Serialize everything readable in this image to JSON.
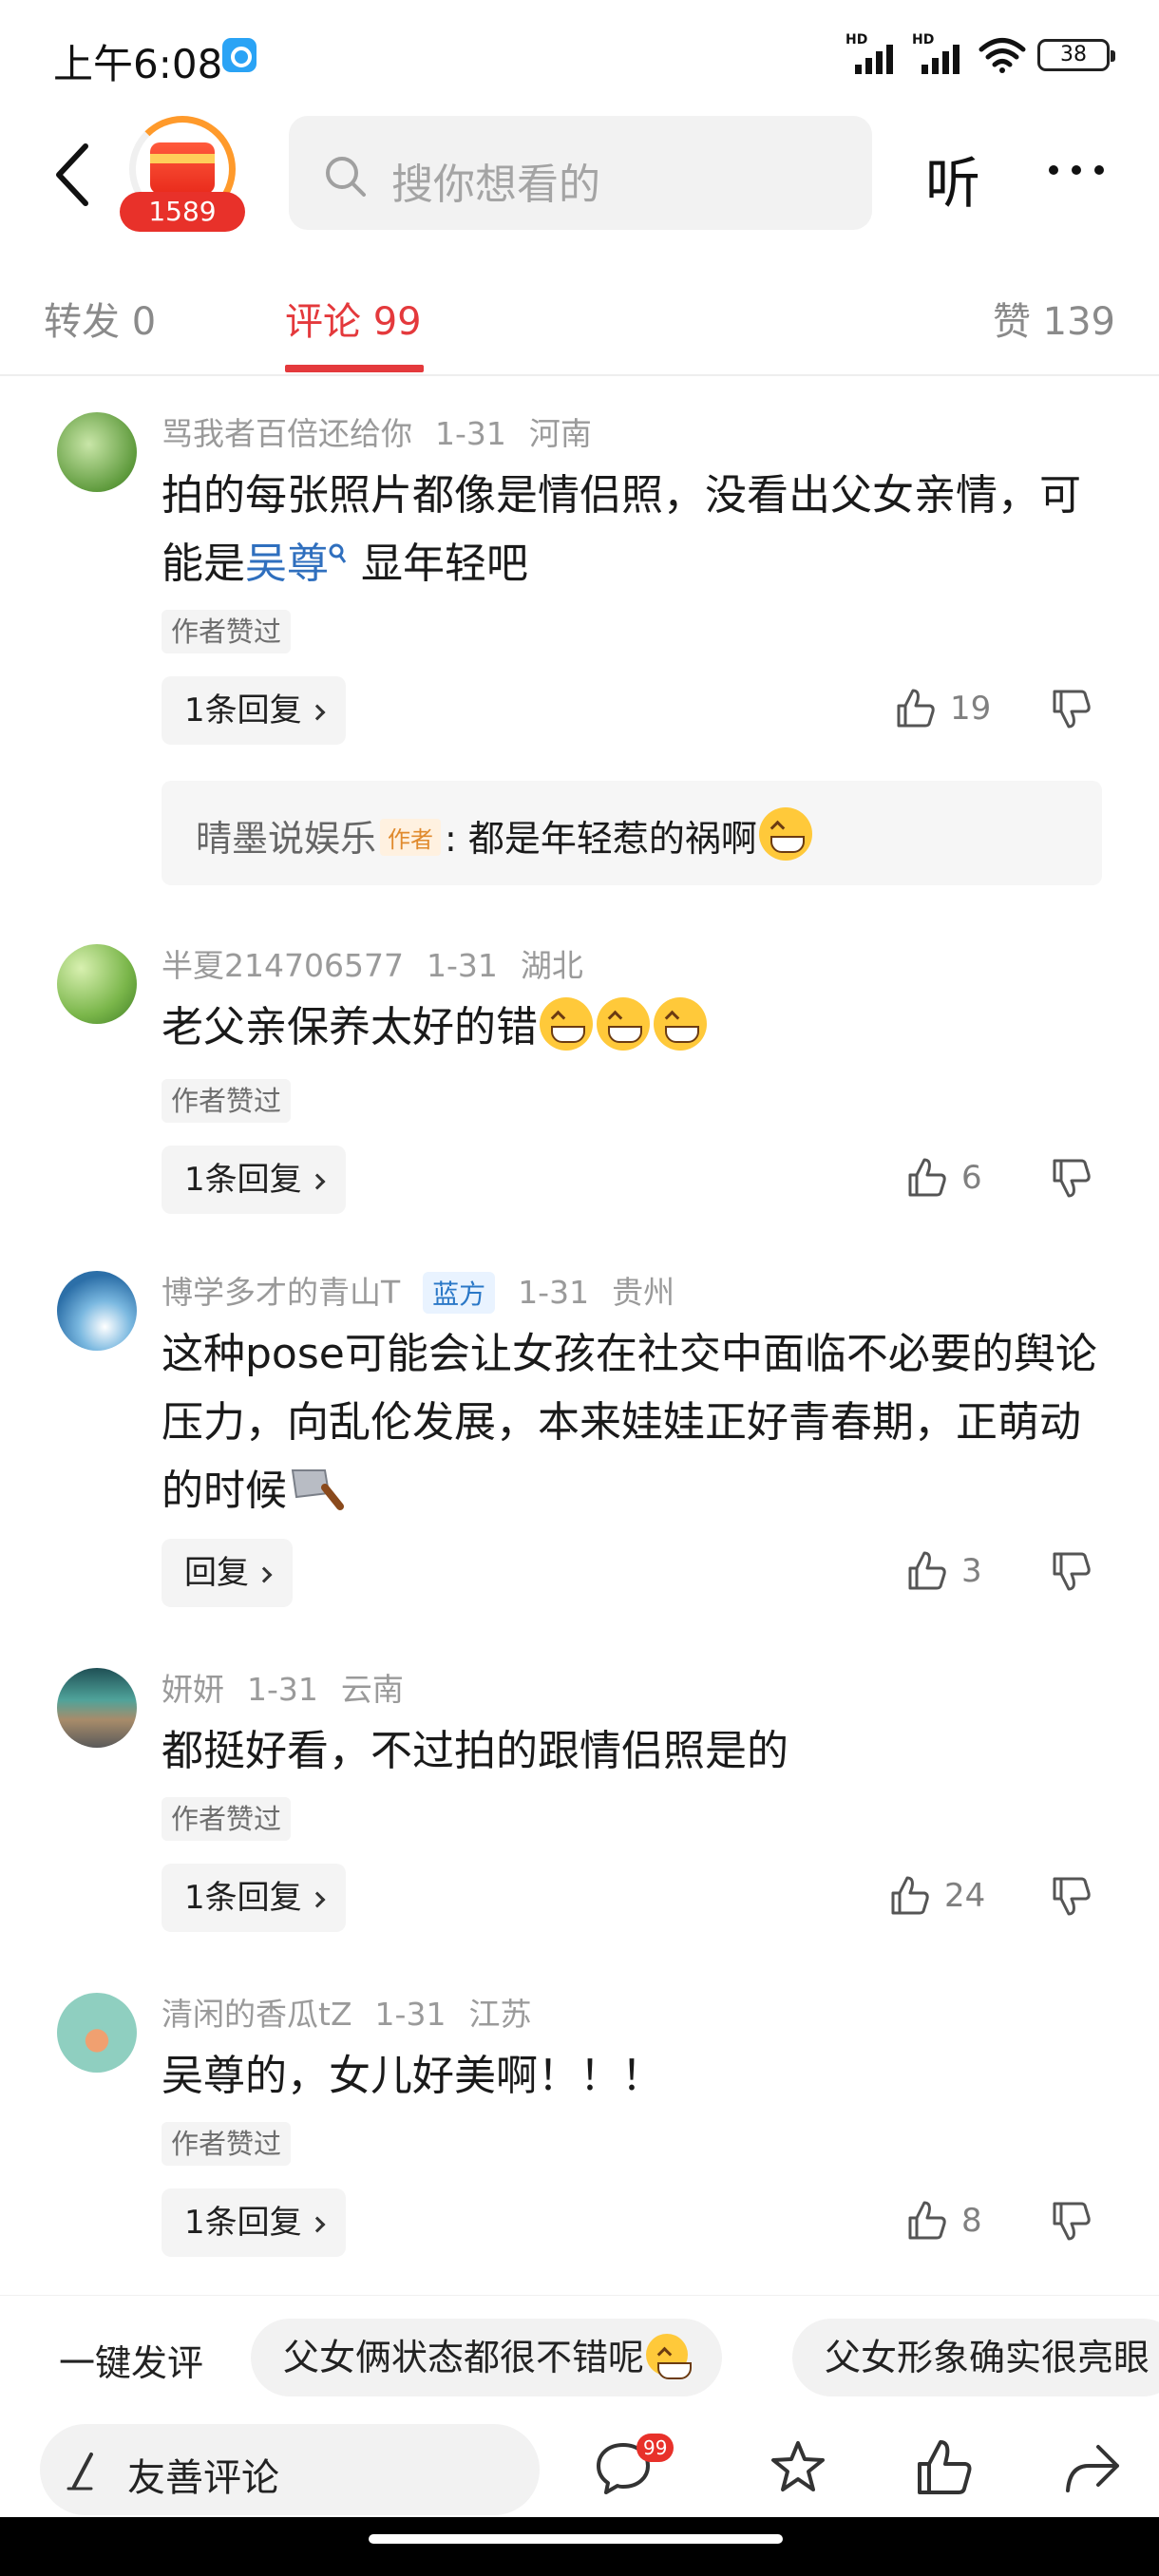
{
  "status_bar": {
    "time": "上午6:08",
    "hd1": "HD",
    "hd2": "HD",
    "battery": "38"
  },
  "header": {
    "reward_count": "1589",
    "search_placeholder": "搜你想看的",
    "listen_label": "听"
  },
  "tabs": {
    "repost": "转发 0",
    "comment": "评论 99",
    "like": "赞 139",
    "active": "comment"
  },
  "comments": [
    {
      "user": "骂我者百倍还给你",
      "date": "1-31",
      "location": "河南",
      "text_before": "拍的每张照片都像是情侣照，没看出父女亲情，可能是",
      "link": "吴尊",
      "text_after": " 显年轻吧",
      "author_liked": "作者赞过",
      "reply_label": "1条回复",
      "likes": "19",
      "sub_reply": {
        "author": "晴墨说娱乐",
        "badge": "作者",
        "text": ": 都是年轻惹的祸啊"
      }
    },
    {
      "user": "半夏214706577",
      "date": "1-31",
      "location": "湖北",
      "text": "老父亲保养太好的错",
      "author_liked": "作者赞过",
      "reply_label": "1条回复",
      "likes": "6"
    },
    {
      "user": "博学多才的青山T",
      "badge": "蓝方",
      "date": "1-31",
      "location": "贵州",
      "text": "这种pose可能会让女孩在社交中面临不必要的舆论压力，向乱伦发展，本来娃娃正好青春期，正萌动的时候",
      "reply_label": "回复",
      "likes": "3"
    },
    {
      "user": "妍妍",
      "date": "1-31",
      "location": "云南",
      "text": "都挺好看，不过拍的跟情侣照是的",
      "author_liked": "作者赞过",
      "reply_label": "1条回复",
      "likes": "24"
    },
    {
      "user": "清闲的香瓜tZ",
      "date": "1-31",
      "location": "江苏",
      "text": "吴尊的，女儿好美啊！！！",
      "author_liked": "作者赞过",
      "reply_label": "1条回复",
      "likes": "8"
    }
  ],
  "quick_bar": {
    "label": "一键发评",
    "chips": [
      "父女俩状态都很不错呢",
      "父女形象确实很亮眼"
    ]
  },
  "bottom_bar": {
    "input_placeholder": "友善评论",
    "comment_badge": "99"
  },
  "colors": {
    "accent": "#e4393c",
    "link": "#2f6fbe",
    "badge_red": "#e8312a"
  }
}
